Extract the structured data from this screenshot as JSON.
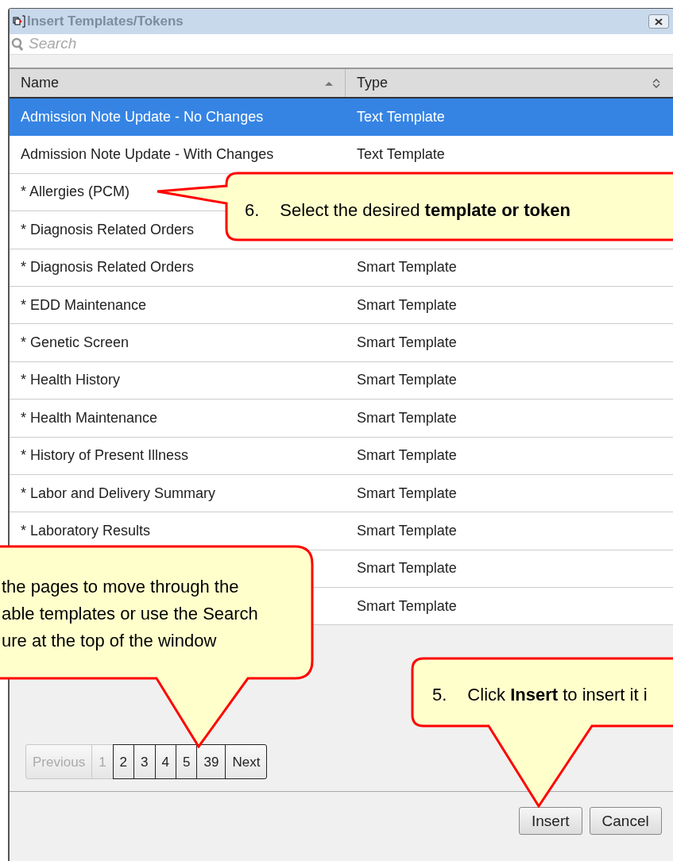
{
  "window": {
    "title": "Insert Templates/Tokens"
  },
  "search": {
    "placeholder": "Search"
  },
  "table": {
    "columns": [
      {
        "label": "Name",
        "sorted": true
      },
      {
        "label": "Type",
        "sorted": false
      }
    ],
    "rows": [
      {
        "name": "Admission Note Update - No Changes",
        "type": "Text Template",
        "selected": true
      },
      {
        "name": "Admission Note Update - With Changes",
        "type": "Text Template",
        "selected": false
      },
      {
        "name": "* Allergies (PCM)",
        "selected": false
      },
      {
        "name": "* Diagnosis Related Orders",
        "selected": false
      },
      {
        "name": "* Diagnosis Related Orders",
        "type": "Smart Template",
        "selected": false
      },
      {
        "name": "* EDD Maintenance",
        "type": "Smart Template",
        "selected": false
      },
      {
        "name": "* Genetic Screen",
        "type": "Smart Template",
        "selected": false
      },
      {
        "name": "* Health History",
        "type": "Smart Template",
        "selected": false
      },
      {
        "name": "* Health Maintenance",
        "type": "Smart Template",
        "selected": false
      },
      {
        "name": "* History of Present Illness",
        "type": "Smart Template",
        "selected": false
      },
      {
        "name": "* Labor and Delivery Summary",
        "type": "Smart Template",
        "selected": false
      },
      {
        "name": "* Laboratory Results",
        "type": "Smart Template",
        "selected": false
      },
      {
        "type": "Smart Template",
        "selected": false
      },
      {
        "type": "Smart Template",
        "selected": false
      }
    ]
  },
  "pager": [
    {
      "label": "Previous",
      "disabled": true
    },
    {
      "label": "1",
      "disabled": true
    },
    {
      "label": "2",
      "disabled": false
    },
    {
      "label": "3",
      "disabled": false
    },
    {
      "label": "4",
      "disabled": false
    },
    {
      "label": "5",
      "disabled": false
    },
    {
      "label": "39",
      "disabled": false
    },
    {
      "label": "Next",
      "disabled": false
    }
  ],
  "buttons": [
    "Insert",
    "Cancel"
  ],
  "callouts": [
    {
      "number": "6.",
      "text": "Select the desired **template or token**"
    },
    {
      "lines": [
        "the pages to move through the",
        "able templates or use the Search",
        "ure at the top of the window"
      ]
    },
    {
      "number": "5.",
      "text": "Click **Insert** to insert it i"
    }
  ]
}
